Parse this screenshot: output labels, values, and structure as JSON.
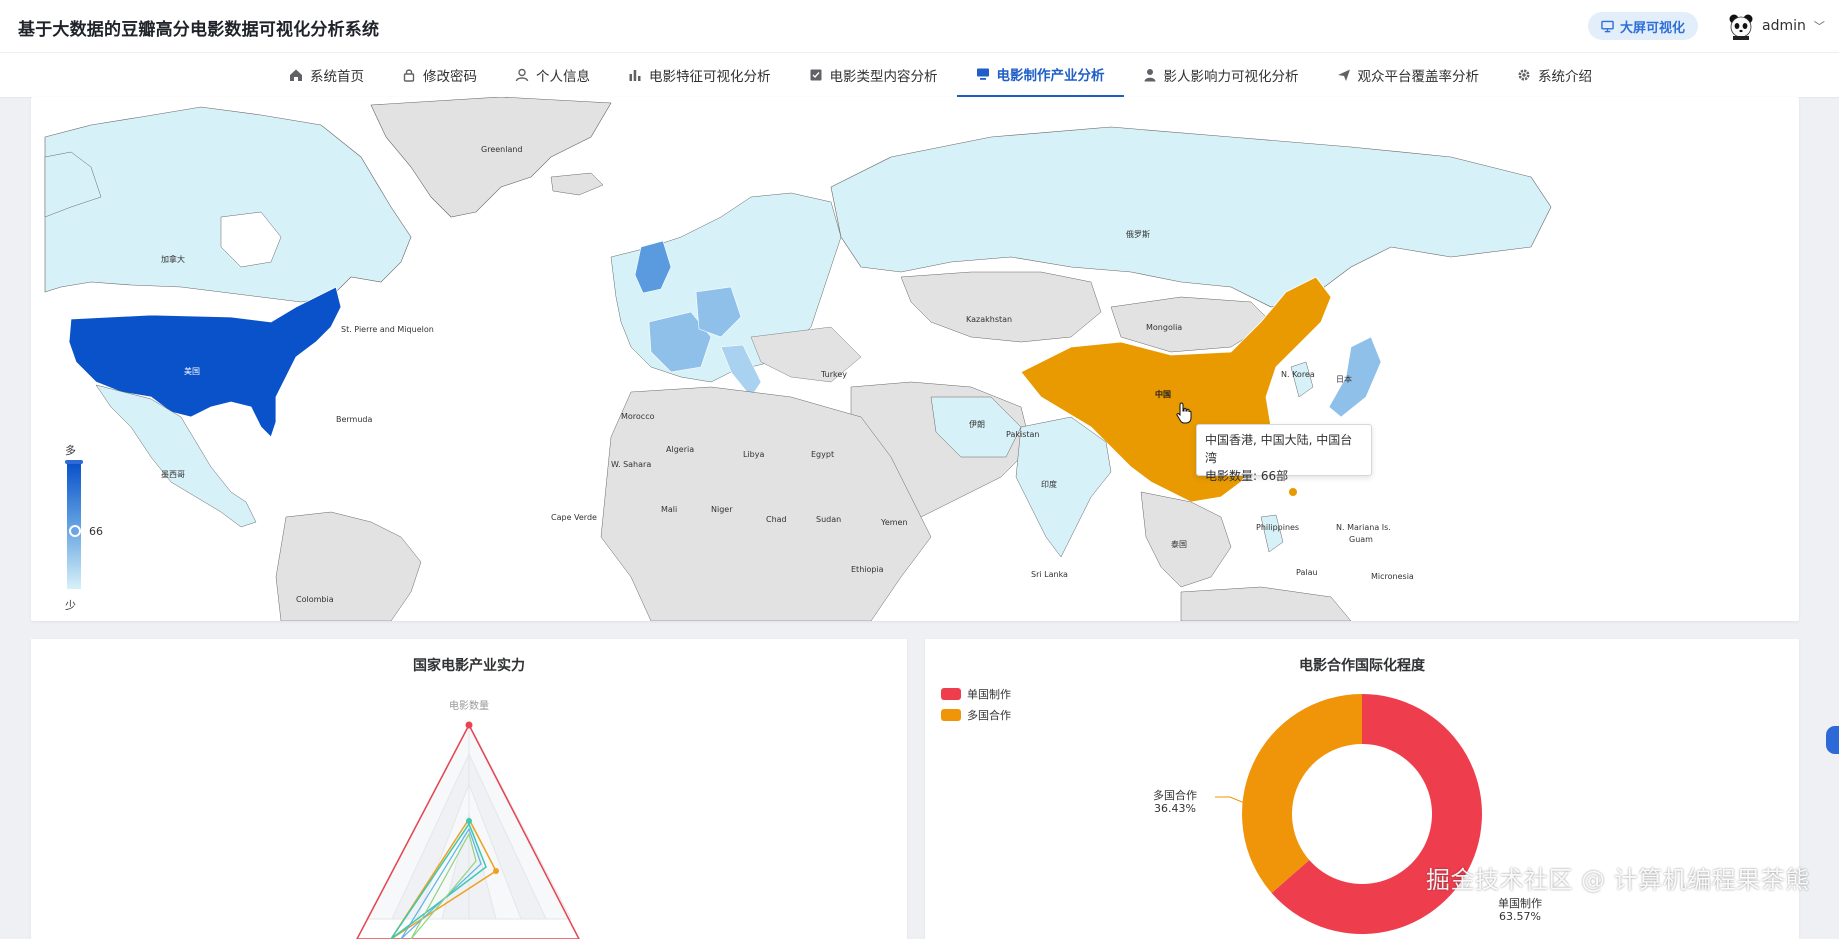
{
  "app": {
    "title": "基于大数据的豆瓣高分电影数据可视化分析系统",
    "bigscreen_label": "大屏可视化",
    "username": "admin"
  },
  "nav": {
    "items": [
      {
        "label": "系统首页",
        "icon": "home-icon"
      },
      {
        "label": "修改密码",
        "icon": "lock-icon"
      },
      {
        "label": "个人信息",
        "icon": "user-icon"
      },
      {
        "label": "电影特征可视化分析",
        "icon": "bar-chart-icon"
      },
      {
        "label": "电影类型内容分析",
        "icon": "checkbox-icon"
      },
      {
        "label": "电影制作产业分析",
        "icon": "monitor-icon",
        "active": true
      },
      {
        "label": "影人影响力可视化分析",
        "icon": "person-icon"
      },
      {
        "label": "观众平台覆盖率分析",
        "icon": "send-icon"
      },
      {
        "label": "系统介绍",
        "icon": "gear-icon"
      }
    ]
  },
  "map": {
    "visual_map": {
      "max_label": "多",
      "min_label": "少",
      "current_value": "66"
    },
    "tooltip": {
      "line1": "中国香港, 中国大陆, 中国台湾",
      "line2": "电影数量: 66部"
    },
    "labels": {
      "greenland": "Greenland",
      "canada": "加拿大",
      "usa": "美国",
      "russia": "俄罗斯",
      "china": "中国",
      "mongolia": "Mongolia",
      "kazakhstan": "Kazakhstan",
      "bermuda": "Bermuda",
      "spm": "St. Pierre and Miquelon",
      "mexico": "墨西哥",
      "algeria": "Algeria",
      "libya": "Libya",
      "egypt": "Egypt",
      "mali": "Mali",
      "niger": "Niger",
      "chad": "Chad",
      "sudan": "Sudan",
      "india": "印度",
      "japan": "日本",
      "nkorea": "N. Korea",
      "pakistan": "Pakistan",
      "iran": "伊朗",
      "turkey": "Turkey",
      "philippines": "Philippines",
      "micronesia": "Micronesia",
      "palau": "Palau",
      "nmariana": "N. Mariana Is.",
      "guam": "Guam",
      "capeverde": "Cape Verde",
      "wsahara": "W. Sahara",
      "morocco": "Morocco",
      "ethiopia": "Ethiopia",
      "yemen": "Yemen",
      "srilanka": "Sri Lanka",
      "thailand": "泰国",
      "colombia": "Colombia"
    },
    "colors": {
      "usa": "#0a52c9",
      "china": "#e89a00",
      "light": "#d7f1f8",
      "mid": "#8ec0ea",
      "gray": "#e2e2e2"
    }
  },
  "radar": {
    "title": "国家电影产业实力",
    "indicator_top": "电影数量"
  },
  "donut": {
    "title": "电影合作国际化程度",
    "legend": [
      {
        "name": "单国制作",
        "color": "#ee3e4e"
      },
      {
        "name": "多国合作",
        "color": "#f0950a"
      }
    ]
  },
  "chart_data": {
    "type": "pie",
    "title": "电影合作国际化程度",
    "slices": [
      {
        "name": "单国制作",
        "percent": 63.57
      },
      {
        "name": "多国合作",
        "percent": 36.43
      }
    ]
  },
  "watermark": "掘金技术社区 @ 计算机编程果茶熊"
}
